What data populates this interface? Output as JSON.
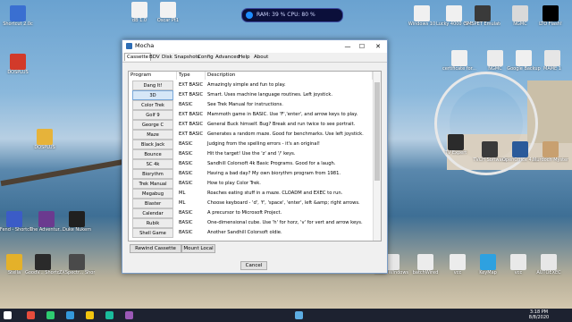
{
  "hud": {
    "text": "RAM: 39 %  CPU: 80 %"
  },
  "desktop_icons": [
    {
      "label": "Shortcut 2.0c",
      "x": "left",
      "color": "#3a6fd1"
    },
    {
      "label": "DOSPLUS",
      "color": "#d23a2a"
    },
    {
      "label": "DOSPLUS",
      "color": "#e6b33a"
    },
    {
      "label": "DFend - Shortcut",
      "color": "#3b5cc7"
    },
    {
      "label": "The Adventur...",
      "color": "#6b3a8f"
    },
    {
      "label": "Duke Nukem",
      "color": "#202020"
    },
    {
      "label": "Stella",
      "color": "#e4b12a"
    },
    {
      "label": "GoodV... Shortcut",
      "color": "#2a2a2a"
    },
    {
      "label": "ZXSpectr... Shortcut",
      "color": "#4a4a4a"
    },
    {
      "label": "dB 1.0",
      "color": "#f2f2f2"
    },
    {
      "label": "Oscar Pt1",
      "color": "#f2f2f2"
    },
    {
      "label": "Windows 10",
      "color": "#f0f0f0"
    },
    {
      "label": "Lucky 4000 CP Emulator",
      "color": "#f0f0f0"
    },
    {
      "label": "SMSPET Emulator",
      "color": "#3a3a3a"
    },
    {
      "label": "NGMC",
      "color": "#d9d9d9"
    },
    {
      "label": "LTO Flash!",
      "color": "#000000"
    },
    {
      "label": "certificate for...",
      "color": "#f0f0f0"
    },
    {
      "label": "NGMC",
      "color": "#ececec"
    },
    {
      "label": "Google Backup",
      "color": "#f0f0f0"
    },
    {
      "label": "MAME 1",
      "color": "#e6e6e6"
    },
    {
      "label": "TV Expert",
      "color": "#2b2b2b"
    },
    {
      "label": "TVCH Software",
      "color": "#3a3a3a"
    },
    {
      "label": "OpenOffice 4.1.7 Shortcut",
      "color": "#2a5a9a"
    },
    {
      "label": "Murdoch Mysteries",
      "color": "#c8a070"
    },
    {
      "label": "Cobol Windows",
      "color": "#e7e7e7"
    },
    {
      "label": "batchWired",
      "color": "#ececec"
    },
    {
      "label": "vcc",
      "color": "#ececec"
    },
    {
      "label": "KeyMap",
      "color": "#2ea1e0"
    },
    {
      "label": "vcc",
      "color": "#e9e9e9"
    },
    {
      "label": "AUTOEXEC",
      "color": "#e7e7e7"
    }
  ],
  "window": {
    "title": "Mocha",
    "controls": {
      "min": "—",
      "max": "☐",
      "close": "✕"
    },
    "tabs": [
      "Cassette",
      "BDV",
      "Disk",
      "Snapshots",
      "Config",
      "Advanced",
      "Help",
      "About"
    ],
    "active_tab": "Cassette",
    "columns": [
      "Program",
      "Type",
      "Description"
    ],
    "rows": [
      {
        "program": "Dang It!",
        "type": "EXT BASIC",
        "desc": "Amazingly simple and fun to play."
      },
      {
        "program": "3D",
        "type": "EXT BASIC",
        "desc": "Smart. Uses machine language routines. Left joystick."
      },
      {
        "program": "Color Trek",
        "type": "BASIC",
        "desc": "See Trek Manual for instructions."
      },
      {
        "program": "Golf 9",
        "type": "EXT BASIC",
        "desc": "Mammoth game in BASIC. Use 'F','enter', and arrow keys to play."
      },
      {
        "program": "George C",
        "type": "EXT BASIC",
        "desc": "General Buck himself. Bug? Break and run twice to see portrait."
      },
      {
        "program": "Maze",
        "type": "EXT BASIC",
        "desc": "Generates a random maze. Good for benchmarks. Use left joystick."
      },
      {
        "program": "Black Jack",
        "type": "BASIC",
        "desc": "Judging from the spelling errors - it's an original!"
      },
      {
        "program": "Bounce",
        "type": "BASIC",
        "desc": "Hit the target! Use the 'z' and '/' keys."
      },
      {
        "program": "SC 4k",
        "type": "BASIC",
        "desc": "Sandhill Colorsoft 4k Basic Programs. Good for a laugh."
      },
      {
        "program": "Biorythm",
        "type": "BASIC",
        "desc": "Having a bad day? My own biorythm program from 1981."
      },
      {
        "program": "Trek Manual",
        "type": "BASIC",
        "desc": "How to play Color Trek."
      },
      {
        "program": "Megabug",
        "type": "ML",
        "desc": "Roaches eating stuff in a maze. CLOADM and EXEC to run."
      },
      {
        "program": "Blaster",
        "type": "ML",
        "desc": "Choose keyboard - 'd', 'f', 'space', 'enter', left &amp; right arrows."
      },
      {
        "program": "Calendar",
        "type": "BASIC",
        "desc": "A precursor to Microsoft Project."
      },
      {
        "program": "Rubik",
        "type": "BASIC",
        "desc": "One-dimensional cube. Use 'h' for horz, 'v' for vert and arrow keys."
      },
      {
        "program": "Shell Game",
        "type": "BASIC",
        "desc": "Another Sandhill Colorsoft oldie."
      }
    ],
    "selected_row": 1,
    "buttons": {
      "rewind": "Rewind Cassette",
      "mount": "Mount Local",
      "cancel": "Cancel"
    }
  },
  "taskbar": {
    "time": "3:18 PM",
    "date": "8/8/2020"
  }
}
